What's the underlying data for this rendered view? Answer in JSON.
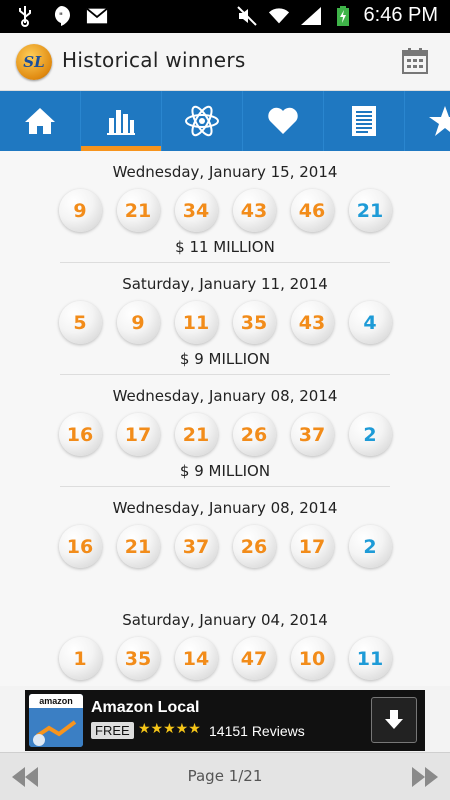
{
  "statusbar": {
    "time": "6:46 PM",
    "icons": [
      "usb-icon",
      "hangouts-icon",
      "gmail-icon",
      "mute-icon",
      "wifi-icon",
      "signal-icon",
      "battery-charging-icon"
    ]
  },
  "header": {
    "logo_text": "SL",
    "title": "Historical winners",
    "action_icon": "calendar-icon"
  },
  "tabs": [
    {
      "name": "home",
      "icon": "home-icon",
      "active": false
    },
    {
      "name": "stats",
      "icon": "bar-chart-icon",
      "active": true
    },
    {
      "name": "atom",
      "icon": "atom-icon",
      "active": false
    },
    {
      "name": "favorites",
      "icon": "heart-icon",
      "active": false
    },
    {
      "name": "list",
      "icon": "document-icon",
      "active": false
    },
    {
      "name": "starred",
      "icon": "star-icon",
      "active": false
    }
  ],
  "draws": [
    {
      "date": "Wednesday, January 15, 2014",
      "numbers": [
        "9",
        "21",
        "34",
        "43",
        "46"
      ],
      "power": "21",
      "jackpot": "$ 11 MILLION"
    },
    {
      "date": "Saturday, January 11, 2014",
      "numbers": [
        "5",
        "9",
        "11",
        "35",
        "43"
      ],
      "power": "4",
      "jackpot": "$ 9 MILLION"
    },
    {
      "date": "Wednesday, January 08, 2014",
      "numbers": [
        "16",
        "17",
        "21",
        "26",
        "37"
      ],
      "power": "2",
      "jackpot": "$ 9 MILLION"
    },
    {
      "date": "Wednesday, January 08, 2014",
      "numbers": [
        "16",
        "21",
        "37",
        "26",
        "17"
      ],
      "power": "2",
      "jackpot": ""
    },
    {
      "date": "Saturday, January 04, 2014",
      "numbers": [
        "1",
        "35",
        "14",
        "47",
        "10"
      ],
      "power": "11",
      "jackpot": ""
    }
  ],
  "ad": {
    "icon_label": "amazon",
    "title": "Amazon Local",
    "free_label": "FREE",
    "rating_stars": "★★★★★",
    "reviews": "14151 Reviews"
  },
  "pager": {
    "label": "Page 1/21"
  },
  "colors": {
    "tabbar": "#1f78c1",
    "active_tab_underline": "#f7941d",
    "white_ball_text": "#f28c1a",
    "power_ball_text": "#1e9bd7"
  }
}
